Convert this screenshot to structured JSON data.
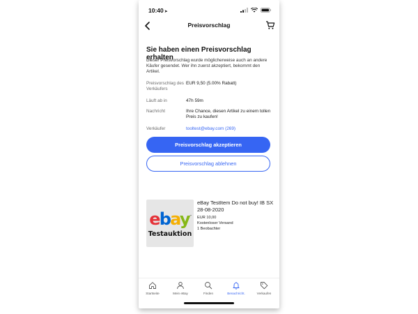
{
  "status_bar": {
    "time": "10:40",
    "location_arrow": "➤"
  },
  "nav": {
    "title": "Preisvorschlag",
    "back_icon": "chevron-left-icon",
    "cart_icon": "cart-icon"
  },
  "offer": {
    "title": "Sie haben einen Preisvorschlag erhalten",
    "description": "Dieser Preisvorschlag wurde möglicherweise auch an andere Käufer gesendet. Wer ihn zuerst akzeptiert, bekommt den Artikel.",
    "rows": [
      {
        "label": "Preisvorschlag des Verkäufers",
        "value": "EUR 9,50 (5.00% Rabatt)"
      },
      {
        "label": "Läuft ab in",
        "value": "47h 59m"
      },
      {
        "label": "Nachricht",
        "value": "Ihre Chance, diesen Artikel zu einem tollen Preis zu kaufen!"
      },
      {
        "label": "Verkäufer",
        "value": "tooltest@ebay.com (269)"
      }
    ],
    "accept_label": "Preisvorschlag akzeptieren",
    "decline_label": "Preisvorschlag ablehnen"
  },
  "item": {
    "thumb_logo": "ebay",
    "thumb_trademark": "™",
    "thumb_text": "Testauktion",
    "title": "eBay TestItem Do not buy! IB SX 28-08-2020",
    "price": "EUR 10,00",
    "shipping": "Kostenloser Versand",
    "watchers": "1 Beobachter"
  },
  "tabs": [
    {
      "label": "Startseite",
      "icon": "home-icon"
    },
    {
      "label": "Mein eBay",
      "icon": "person-icon"
    },
    {
      "label": "Finden",
      "icon": "search-icon"
    },
    {
      "label": "Benachricht.",
      "icon": "bell-icon",
      "active": true
    },
    {
      "label": "Verkaufen",
      "icon": "tag-icon"
    }
  ],
  "colors": {
    "accent": "#3665f3",
    "ebay_red": "#e53238",
    "ebay_blue": "#0064d2",
    "ebay_yellow": "#f5af02",
    "ebay_green": "#86b817"
  }
}
